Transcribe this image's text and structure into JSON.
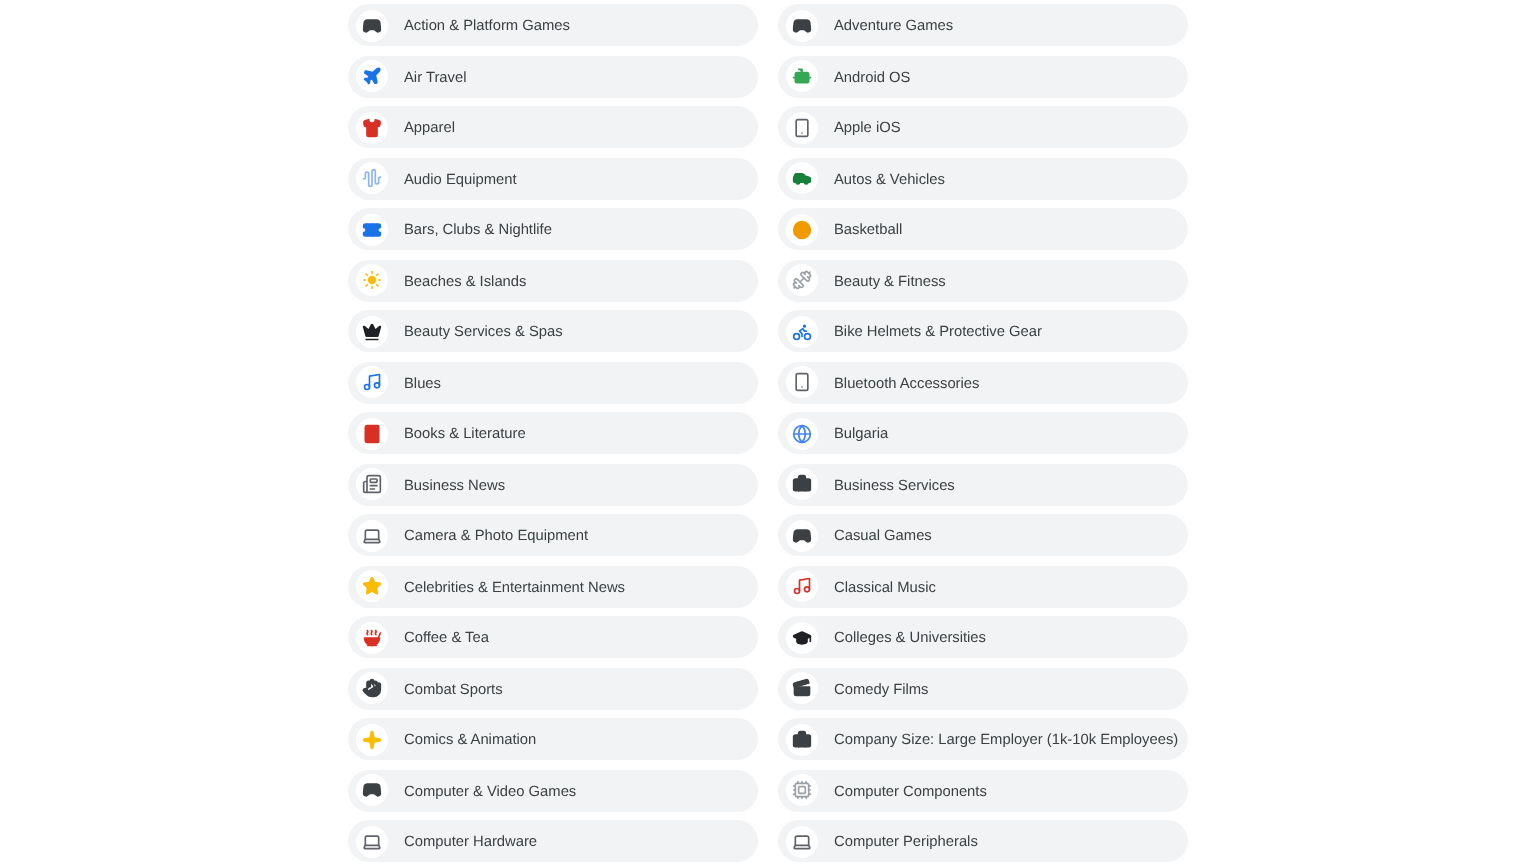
{
  "columns": [
    {
      "items": [
        {
          "label": "Action & Platform Games"
        },
        {
          "label": "Air Travel"
        },
        {
          "label": "Apparel"
        },
        {
          "label": "Audio Equipment"
        },
        {
          "label": "Bars, Clubs & Nightlife"
        },
        {
          "label": "Beaches & Islands"
        },
        {
          "label": "Beauty Services & Spas"
        },
        {
          "label": "Blues"
        },
        {
          "label": "Books & Literature"
        },
        {
          "label": "Business News"
        },
        {
          "label": "Camera & Photo Equipment"
        },
        {
          "label": "Celebrities & Entertainment News"
        },
        {
          "label": "Coffee & Tea"
        },
        {
          "label": "Combat Sports"
        },
        {
          "label": "Comics & Animation"
        },
        {
          "label": "Computer & Video Games"
        },
        {
          "label": "Computer Hardware"
        }
      ]
    },
    {
      "items": [
        {
          "label": "Adventure Games"
        },
        {
          "label": "Android OS"
        },
        {
          "label": "Apple iOS"
        },
        {
          "label": "Autos & Vehicles"
        },
        {
          "label": "Basketball"
        },
        {
          "label": "Beauty & Fitness"
        },
        {
          "label": "Bike Helmets & Protective Gear"
        },
        {
          "label": "Bluetooth Accessories"
        },
        {
          "label": "Bulgaria"
        },
        {
          "label": "Business Services"
        },
        {
          "label": "Casual Games"
        },
        {
          "label": "Classical Music"
        },
        {
          "label": "Colleges & Universities"
        },
        {
          "label": "Comedy Films"
        },
        {
          "label": "Company Size: Large Employer (1k-10k Employees)"
        },
        {
          "label": "Computer Components"
        },
        {
          "label": "Computer Peripherals"
        }
      ]
    }
  ]
}
